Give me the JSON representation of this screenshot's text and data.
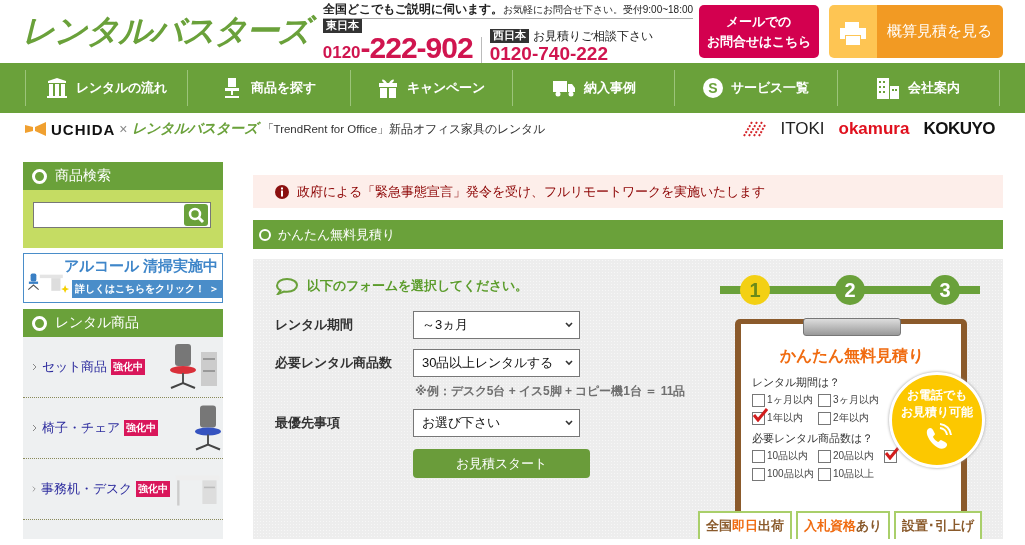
{
  "header": {
    "logo": "レンタルバスターズ",
    "tagline": "全国どこでもご説明に伺います。",
    "tagline_note": "お気軽にお問合せ下さい。受付9:00~18:00",
    "east_label": "東日本",
    "east_prefix": "0120",
    "east_number": "-222-902",
    "west_label": "西日本",
    "west_note": "お見積りご相談下さい",
    "west_number": "0120-740-222",
    "mail_button": [
      "メールでの",
      "お問合せはこちら"
    ],
    "estimate_button": "概算見積を見る"
  },
  "nav": [
    {
      "label": "レンタルの流れ"
    },
    {
      "label": "商品を探す"
    },
    {
      "label": "キャンペーン"
    },
    {
      "label": "納入事例"
    },
    {
      "label": "サービス一覧",
      "icon_text": "S"
    },
    {
      "label": "会社案内"
    }
  ],
  "partner": {
    "uchida": "UCHIDA",
    "cross": "×",
    "brand": "レンタルバスターズ",
    "text": "「TrendRent for Office」新品オフィス家具のレンタル",
    "makers": [
      "ITOKI",
      "okamura",
      "KOKUYO"
    ]
  },
  "sidebar": {
    "search_title": "商品検索",
    "banner": {
      "title": "アルコール 清掃実施中",
      "link": "詳しくはこちらをクリック！",
      "arrow": "＞"
    },
    "products_title": "レンタル商品",
    "products": [
      {
        "label": "セット商品",
        "badge": "強化中"
      },
      {
        "label": "椅子・チェア",
        "badge": "強化中"
      },
      {
        "label": "事務机・デスク",
        "badge": "強化中"
      }
    ]
  },
  "main": {
    "alert": "政府による「緊急事態宣言」発令を受け、フルリモートワークを実施いたします",
    "section_title": "かんたん無料見積り",
    "prompt": "以下のフォームを選択してください。",
    "fields": [
      {
        "label": "レンタル期間",
        "value": "～3ヵ月"
      },
      {
        "label": "必要レンタル商品数",
        "value": "30品以上レンタルする",
        "note": "※例：デスク5台 + イス5脚 + コピー機1台 ＝ 11品"
      },
      {
        "label": "最優先事項",
        "value": "お選び下さい"
      }
    ],
    "submit": "お見積スタート",
    "steps": [
      {
        "label": "1",
        "selected": true
      },
      {
        "label": "2",
        "selected": false
      },
      {
        "label": "3",
        "selected": false
      }
    ],
    "clipboard": {
      "title": "かんたん無料見積り",
      "groups": [
        {
          "question": "レンタル期間は？",
          "options": [
            {
              "label": "1ヶ月以内",
              "checked": false
            },
            {
              "label": "3ヶ月以内",
              "checked": false
            },
            {
              "label": "1年以内",
              "checked": true
            },
            {
              "label": "2年以内",
              "checked": false
            }
          ]
        },
        {
          "question": "必要レンタル商品数は？",
          "options": [
            {
              "label": "10品以内",
              "checked": false
            },
            {
              "label": "20品以内",
              "checked": false
            },
            {
              "checked": true
            },
            {
              "label": "100品以内",
              "checked": false
            },
            {
              "label": "10品以上",
              "checked": false
            }
          ]
        }
      ]
    },
    "bubble": [
      "お電話でも",
      "お見積り可能"
    ],
    "badges": [
      "全国**即日**出荷",
      "**入札資格**あり",
      "設置･引上げ"
    ]
  }
}
